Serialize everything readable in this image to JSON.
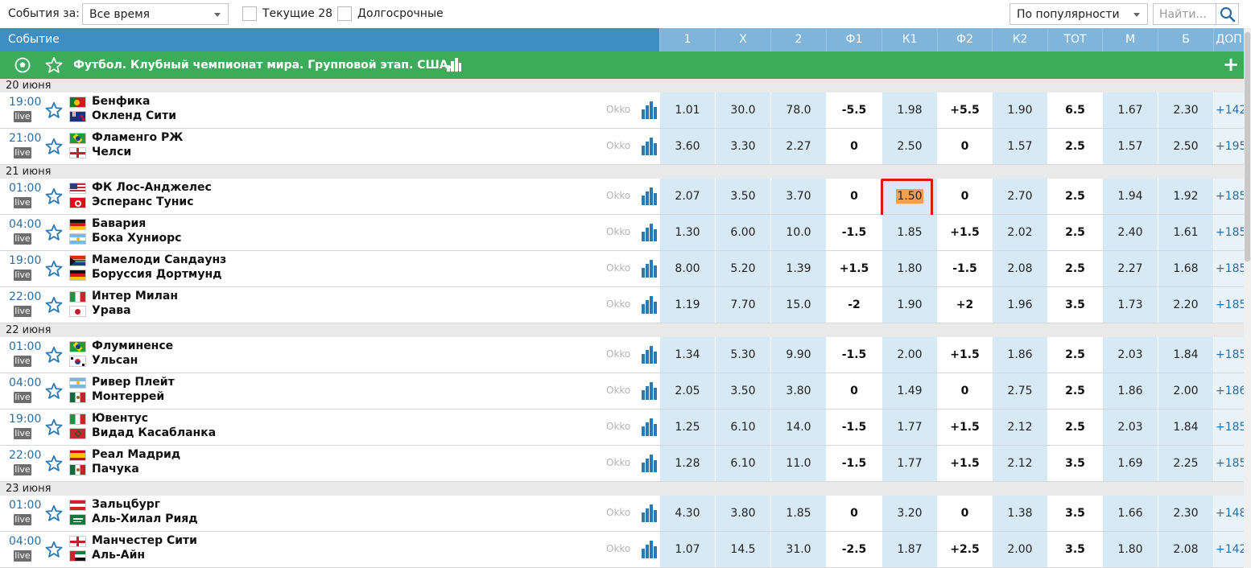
{
  "toolbar": {
    "events_label": "События за:",
    "period_value": "Все время",
    "current_label": "Текущие 28",
    "longterm_label": "Долгосрочные",
    "sort_value": "По популярности",
    "search_placeholder": "Найти..."
  },
  "header": {
    "event_col": "Событие",
    "odds_cols": [
      "1",
      "X",
      "2",
      "Ф1",
      "К1",
      "Ф2",
      "К2",
      "ТОТ",
      "М",
      "Б",
      "ДОП"
    ]
  },
  "competition": {
    "title": "Футбол. Клубный чемпионат мира. Групповой этап. США.",
    "expand_label": "+"
  },
  "broadcaster": "Okko",
  "live_label": "live",
  "groups": [
    {
      "date": "20 июня",
      "events": [
        {
          "time": "19:00",
          "team1": "Бенфика",
          "team2": "Окленд Сити",
          "flag1": "portugal",
          "flag2": "new-zealand",
          "odds": [
            "1.01",
            "30.0",
            "78.0",
            "-5.5",
            "1.98",
            "+5.5",
            "1.90",
            "6.5",
            "1.67",
            "2.30",
            "+142"
          ]
        },
        {
          "time": "21:00",
          "team1": "Фламенго РЖ",
          "team2": "Челси",
          "flag1": "brazil",
          "flag2": "england",
          "odds": [
            "3.60",
            "3.30",
            "2.27",
            "0",
            "2.50",
            "0",
            "1.57",
            "2.5",
            "1.57",
            "2.50",
            "+195"
          ]
        }
      ]
    },
    {
      "date": "21 июня",
      "events": [
        {
          "time": "01:00",
          "team1": "ФК Лос-Анджелес",
          "team2": "Эсперанс Тунис",
          "flag1": "usa",
          "flag2": "tunisia",
          "odds": [
            "2.07",
            "3.50",
            "3.70",
            "0",
            "1.50",
            "0",
            "2.70",
            "2.5",
            "1.94",
            "1.92",
            "+185"
          ],
          "highlight": 4
        },
        {
          "time": "04:00",
          "team1": "Бавария",
          "team2": "Бока Хуниорс",
          "flag1": "germany",
          "flag2": "argentina",
          "odds": [
            "1.30",
            "6.00",
            "10.0",
            "-1.5",
            "1.85",
            "+1.5",
            "2.02",
            "2.5",
            "2.40",
            "1.61",
            "+185"
          ]
        },
        {
          "time": "19:00",
          "team1": "Мамелоди Сандаунз",
          "team2": "Боруссия Дортмунд",
          "flag1": "south-africa",
          "flag2": "germany",
          "odds": [
            "8.00",
            "5.20",
            "1.39",
            "+1.5",
            "1.80",
            "-1.5",
            "2.08",
            "2.5",
            "2.27",
            "1.68",
            "+185"
          ]
        },
        {
          "time": "22:00",
          "team1": "Интер Милан",
          "team2": "Урава",
          "flag1": "italy",
          "flag2": "japan",
          "odds": [
            "1.19",
            "7.70",
            "15.0",
            "-2",
            "1.90",
            "+2",
            "1.96",
            "3.5",
            "1.73",
            "2.20",
            "+185"
          ]
        }
      ]
    },
    {
      "date": "22 июня",
      "events": [
        {
          "time": "01:00",
          "team1": "Флуминенсе",
          "team2": "Ульсан",
          "flag1": "brazil",
          "flag2": "korea",
          "odds": [
            "1.34",
            "5.30",
            "9.90",
            "-1.5",
            "2.00",
            "+1.5",
            "1.86",
            "2.5",
            "2.03",
            "1.84",
            "+185"
          ]
        },
        {
          "time": "04:00",
          "team1": "Ривер Плейт",
          "team2": "Монтеррей",
          "flag1": "argentina",
          "flag2": "mexico",
          "odds": [
            "2.05",
            "3.50",
            "3.80",
            "0",
            "1.49",
            "0",
            "2.75",
            "2.5",
            "1.86",
            "2.00",
            "+186"
          ]
        },
        {
          "time": "19:00",
          "team1": "Ювентус",
          "team2": "Видад Касабланка",
          "flag1": "italy",
          "flag2": "morocco",
          "odds": [
            "1.25",
            "6.10",
            "14.0",
            "-1.5",
            "1.77",
            "+1.5",
            "2.12",
            "2.5",
            "2.03",
            "1.84",
            "+185"
          ]
        },
        {
          "time": "22:00",
          "team1": "Реал Мадрид",
          "team2": "Пачука",
          "flag1": "spain",
          "flag2": "mexico",
          "odds": [
            "1.28",
            "6.10",
            "11.0",
            "-1.5",
            "1.77",
            "+1.5",
            "2.12",
            "3.5",
            "1.69",
            "2.25",
            "+185"
          ]
        }
      ]
    },
    {
      "date": "23 июня",
      "events": [
        {
          "time": "01:00",
          "team1": "Зальцбург",
          "team2": "Аль-Хилал Рияд",
          "flag1": "austria",
          "flag2": "saudi-arabia",
          "odds": [
            "4.30",
            "3.80",
            "1.85",
            "0",
            "3.20",
            "0",
            "1.38",
            "3.5",
            "1.66",
            "2.30",
            "+148"
          ]
        },
        {
          "time": "04:00",
          "team1": "Манчестер Сити",
          "team2": "Аль-Айн",
          "flag1": "england",
          "flag2": "uae",
          "odds": [
            "1.07",
            "14.5",
            "31.0",
            "-2.5",
            "1.87",
            "+2.5",
            "2.00",
            "3.5",
            "1.80",
            "2.08",
            "+142"
          ]
        }
      ]
    }
  ],
  "colors": {
    "header_blue": "#3d8fc3",
    "odds_header": "#7fb4db",
    "competition_green": "#3cac5b",
    "odds_cell": "#d6e9f5",
    "highlight_orange": "#f2a04f",
    "highlight_border": "#d81a1a"
  }
}
